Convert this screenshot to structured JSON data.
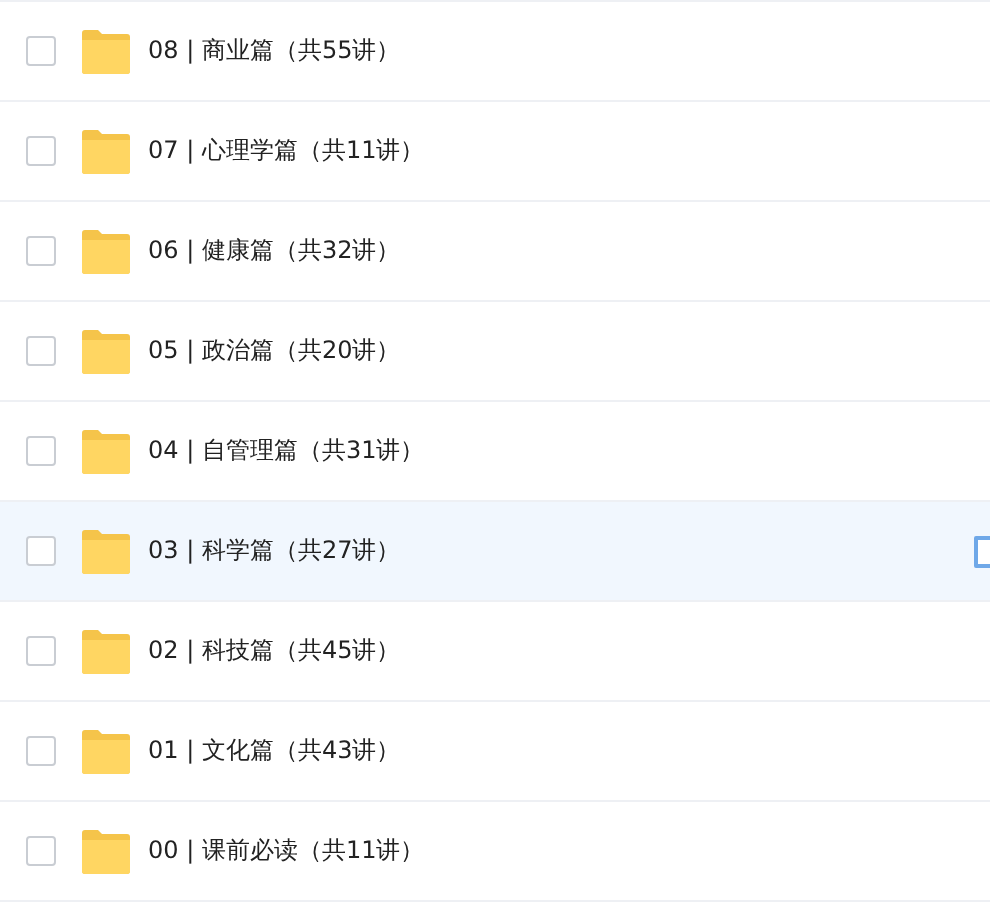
{
  "folders": [
    {
      "name": "08 | 商业篇（共55讲）",
      "checked": false,
      "highlighted": false
    },
    {
      "name": "07 | 心理学篇（共11讲）",
      "checked": false,
      "highlighted": false
    },
    {
      "name": "06 | 健康篇（共32讲）",
      "checked": false,
      "highlighted": false
    },
    {
      "name": "05 | 政治篇（共20讲）",
      "checked": false,
      "highlighted": false
    },
    {
      "name": "04 | 自管理篇（共31讲）",
      "checked": false,
      "highlighted": false
    },
    {
      "name": "03 | 科学篇（共27讲）",
      "checked": false,
      "highlighted": true
    },
    {
      "name": "02 | 科技篇（共45讲）",
      "checked": false,
      "highlighted": false
    },
    {
      "name": "01 | 文化篇（共43讲）",
      "checked": false,
      "highlighted": false
    },
    {
      "name": "00 | 课前必读（共11讲）",
      "checked": false,
      "highlighted": false
    }
  ]
}
